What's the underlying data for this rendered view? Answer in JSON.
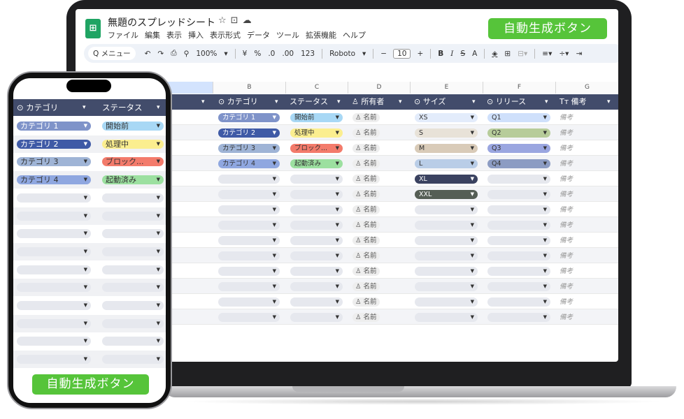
{
  "laptop": {
    "doc_title": "無題のスプレッドシート",
    "title_icons": [
      "star-icon",
      "move-folder-icon",
      "cloud-status-icon"
    ],
    "menu": [
      "ファイル",
      "編集",
      "表示",
      "挿入",
      "表示形式",
      "データ",
      "ツール",
      "拡張機能",
      "ヘルプ"
    ],
    "auto_button": "自動生成ボタン",
    "toolbar": {
      "search": "Q メニュー",
      "zoom": "100%",
      "currency": "¥",
      "percent": "%",
      "decrease_decimal": ".0",
      "increase_decimal": ".00",
      "number_format": "123",
      "font": "Roboto",
      "font_size": "10",
      "bold": "B",
      "italic": "I",
      "strike": "S",
      "text_color": "A"
    },
    "column_letters": [
      "B",
      "C",
      "D",
      "E",
      "F",
      "G"
    ],
    "headers": [
      {
        "label": "カテゴリ",
        "icon": "dropdown-chip-icon"
      },
      {
        "label": "ステータス",
        "icon": ""
      },
      {
        "label": "所有者",
        "icon": "person-icon"
      },
      {
        "label": "サイズ",
        "icon": "dropdown-chip-icon"
      },
      {
        "label": "リリース",
        "icon": "dropdown-chip-icon"
      },
      {
        "label": "備考",
        "icon": "text-icon"
      }
    ],
    "owner_placeholder": "名前",
    "memo_placeholder": "備考",
    "rows": [
      {
        "category": "カテゴリ 1",
        "status": "開始前",
        "size": "XS",
        "release": "Q1"
      },
      {
        "category": "カテゴリ 2",
        "status": "処理中",
        "size": "S",
        "release": "Q2"
      },
      {
        "category": "カテゴリ 3",
        "status": "ブロック...",
        "size": "M",
        "release": "Q3"
      },
      {
        "category": "カテゴリ 4",
        "status": "起動済み",
        "size": "L",
        "release": "Q4"
      },
      {
        "category": "",
        "status": "",
        "size": "XL",
        "release": ""
      },
      {
        "category": "",
        "status": "",
        "size": "XXL",
        "release": ""
      },
      {
        "category": "",
        "status": "",
        "size": "",
        "release": ""
      },
      {
        "category": "",
        "status": "",
        "size": "",
        "release": ""
      },
      {
        "category": "",
        "status": "",
        "size": "",
        "release": ""
      },
      {
        "category": "",
        "status": "",
        "size": "",
        "release": ""
      },
      {
        "category": "",
        "status": "",
        "size": "",
        "release": ""
      },
      {
        "category": "",
        "status": "",
        "size": "",
        "release": ""
      },
      {
        "category": "",
        "status": "",
        "size": "",
        "release": ""
      },
      {
        "category": "",
        "status": "",
        "size": "",
        "release": ""
      }
    ]
  },
  "phone": {
    "headers": [
      "カテゴリ",
      "ステータス"
    ],
    "auto_button": "自動生成ボタン",
    "rows": [
      {
        "category": "カテゴリ 1",
        "status": "開始前"
      },
      {
        "category": "カテゴリ 2",
        "status": "処理中"
      },
      {
        "category": "カテゴリ 3",
        "status": "ブロック..."
      },
      {
        "category": "カテゴリ 4",
        "status": "起動済み"
      },
      {
        "category": "",
        "status": ""
      },
      {
        "category": "",
        "status": ""
      },
      {
        "category": "",
        "status": ""
      },
      {
        "category": "",
        "status": ""
      },
      {
        "category": "",
        "status": ""
      },
      {
        "category": "",
        "status": ""
      },
      {
        "category": "",
        "status": ""
      },
      {
        "category": "",
        "status": ""
      },
      {
        "category": "",
        "status": ""
      },
      {
        "category": "",
        "status": ""
      }
    ]
  },
  "colors": {
    "header_bg": "#424c6b",
    "button_green": "#56c43a",
    "category": [
      "#7f93c9",
      "#3f5aa6",
      "#9fb4d6",
      "#8fa7e0"
    ],
    "category_text": [
      "#ffffff",
      "#ffffff",
      "#333333",
      "#333333"
    ],
    "status": [
      "#a8d8f5",
      "#fbee8f",
      "#f37b6b",
      "#9ce0a0"
    ],
    "size": [
      "#e3ecfb",
      "#e8e2d8",
      "#d9cbb8",
      "#b9cde7",
      "#3a4260",
      "#555e55"
    ],
    "size_text": [
      "#333333",
      "#333333",
      "#333333",
      "#333333",
      "#ffffff",
      "#ffffff"
    ],
    "release": [
      "#cfe0fb",
      "#b7cc9a",
      "#9aa6e0",
      "#8c9cc3"
    ],
    "empty_chip": "#e6e8ee"
  }
}
